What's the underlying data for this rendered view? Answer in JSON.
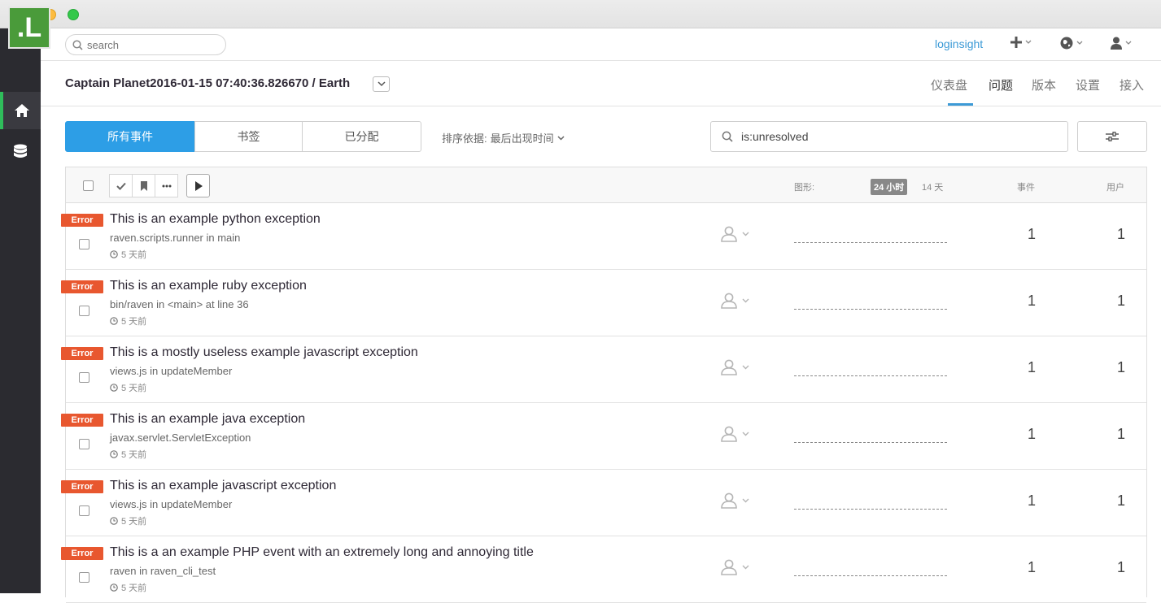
{
  "window": {
    "controls": [
      "close",
      "minimize",
      "maximize"
    ]
  },
  "sidebar": {
    "logo_text": ".L",
    "items": [
      {
        "icon": "home-icon",
        "active": true
      },
      {
        "icon": "database-icon",
        "active": false
      }
    ]
  },
  "topbar": {
    "search_placeholder": "search",
    "user_link": "loginsight",
    "icons": [
      "plus-icon",
      "globe-icon",
      "user-icon"
    ]
  },
  "header": {
    "title": "Captain Planet2016-01-15 07:40:36.826670 / Earth",
    "tabs": [
      "仪表盘",
      "问题",
      "版本",
      "设置",
      "接入"
    ],
    "active_tab": "问题"
  },
  "toolbar": {
    "segments": [
      "所有事件",
      "书签",
      "已分配"
    ],
    "active_segment": "所有事件",
    "sort_label": "排序依据:",
    "sort_value": "最后出现时间",
    "query": "is:unresolved"
  },
  "table": {
    "graph_label": "图形:",
    "range_options": [
      "24 小时",
      "14 天"
    ],
    "active_range": "24 小时",
    "events_label": "事件",
    "users_label": "用户",
    "rows": [
      {
        "level": "Error",
        "title": "This is an example python exception",
        "culprit": "raven.scripts.runner in main",
        "time": "5 天前",
        "events": "1",
        "users": "1"
      },
      {
        "level": "Error",
        "title": "This is an example ruby exception",
        "culprit": "bin/raven in <main> at line 36",
        "time": "5 天前",
        "events": "1",
        "users": "1"
      },
      {
        "level": "Error",
        "title": "This is a mostly useless example javascript exception",
        "culprit": "views.js in updateMember",
        "time": "5 天前",
        "events": "1",
        "users": "1"
      },
      {
        "level": "Error",
        "title": "This is an example java exception",
        "culprit": "javax.servlet.ServletException",
        "time": "5 天前",
        "events": "1",
        "users": "1"
      },
      {
        "level": "Error",
        "title": "This is an example javascript exception",
        "culprit": "views.js in updateMember",
        "time": "5 天前",
        "events": "1",
        "users": "1"
      },
      {
        "level": "Error",
        "title": "This is a an example PHP event with an extremely long and annoying title",
        "culprit": "raven in raven_cli_test",
        "time": "5 天前",
        "events": "1",
        "users": "1"
      }
    ]
  },
  "colors": {
    "accent": "#2d9ee6",
    "error": "#e8572f",
    "sidebar": "#2b2b30",
    "logo": "#4a9b3a",
    "active_indicator": "#2fbd5b"
  }
}
